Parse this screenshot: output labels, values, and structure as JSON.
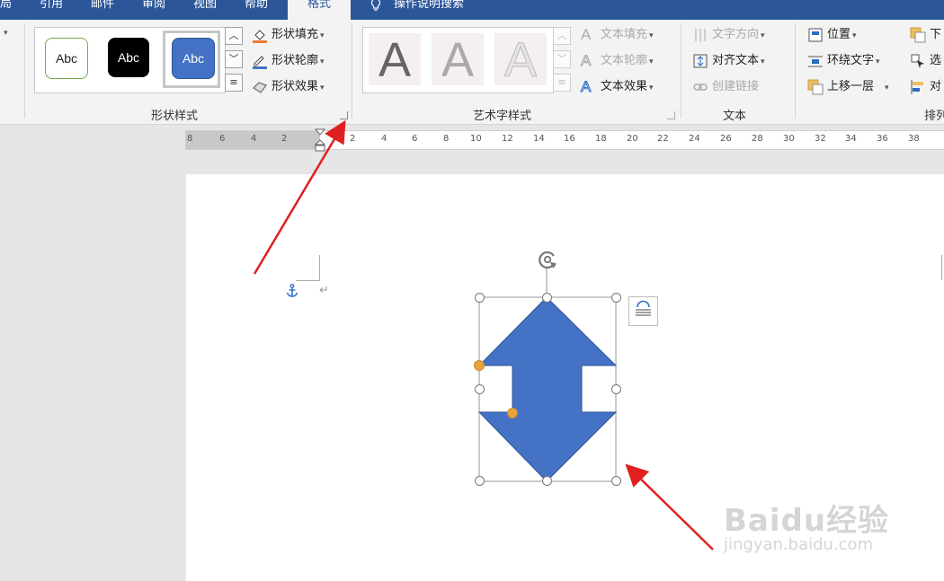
{
  "tabs": [
    {
      "label": "局"
    },
    {
      "label": "引用"
    },
    {
      "label": "邮件"
    },
    {
      "label": "审阅"
    },
    {
      "label": "视图"
    },
    {
      "label": "帮助"
    },
    {
      "label": "格式",
      "active": true
    },
    {
      "label": "操作说明搜索"
    }
  ],
  "ribbon": {
    "shape_styles": {
      "label": "形状样式",
      "gallery": [
        "Abc",
        "Abc",
        "Abc"
      ],
      "commands": {
        "fill": "形状填充",
        "outline": "形状轮廓",
        "effects": "形状效果"
      }
    },
    "wordart_styles": {
      "label": "艺术字样式",
      "gallery": [
        "A",
        "A",
        "A"
      ],
      "commands": {
        "text_fill": "文本填充",
        "text_outline": "文本轮廓",
        "text_effects": "文本效果"
      }
    },
    "text": {
      "label": "文本",
      "commands": {
        "direction": "文字方向",
        "align": "对齐文本",
        "link": "创建链接"
      }
    },
    "arrange": {
      "label": "排列",
      "commands": {
        "position": "位置",
        "wrap": "环绕文字",
        "forward": "上移一层",
        "backward": "下",
        "select": "选",
        "align": "对"
      }
    }
  },
  "ruler": {
    "ticks": [
      "8",
      "6",
      "4",
      "2",
      "2",
      "4",
      "6",
      "8",
      "10",
      "12",
      "14",
      "16",
      "18",
      "20",
      "22",
      "24",
      "26",
      "28",
      "30",
      "32",
      "34",
      "36",
      "38"
    ]
  },
  "document": {
    "paragraph_mark": "↵"
  },
  "watermark": {
    "brand": "Baidu经验",
    "url": "jingyan.baidu.com"
  },
  "colors": {
    "title_bar": "#2b579a",
    "shape_fill": "#4472c4",
    "annotation_arrow": "#e02020",
    "adjust_handle": "#e8a33d"
  }
}
